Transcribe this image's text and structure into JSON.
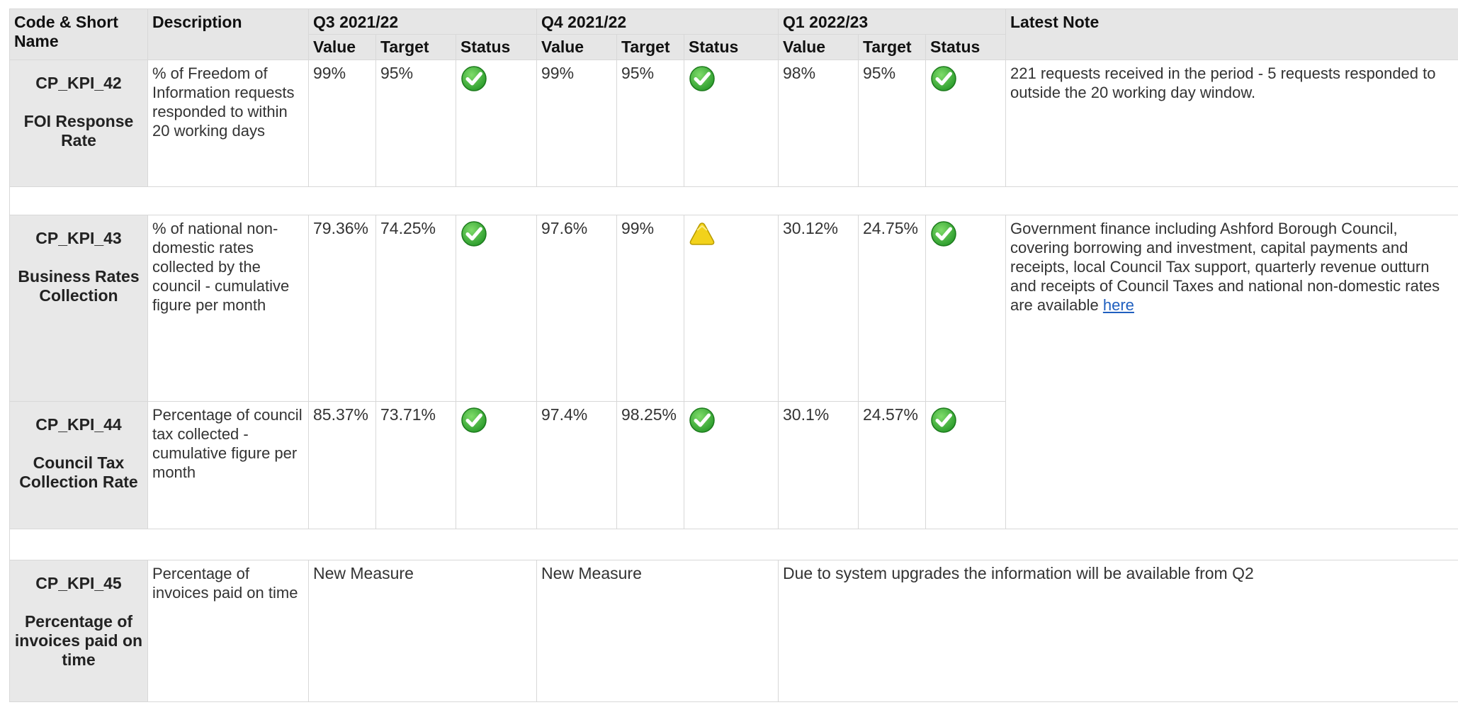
{
  "headers": {
    "code_name": "Code & Short Name",
    "description": "Description",
    "periods": [
      "Q3 2021/22",
      "Q4 2021/22",
      "Q1 2022/23"
    ],
    "value": "Value",
    "target": "Target",
    "status": "Status",
    "latest_note": "Latest Note"
  },
  "rows": [
    {
      "code": "CP_KPI_42",
      "name": "FOI Response Rate",
      "description": "% of Freedom of Information requests responded to within 20 working days",
      "q3": {
        "value": "99%",
        "target": "95%",
        "status": "check-icon"
      },
      "q4": {
        "value": "99%",
        "target": "95%",
        "status": "check-icon"
      },
      "q1": {
        "value": "98%",
        "target": "95%",
        "status": "check-icon"
      },
      "note": "221 requests received in the period - 5 requests responded to outside the 20 working day window."
    },
    {
      "code": "CP_KPI_43",
      "name": "Business Rates Collection",
      "description": "% of national non-domestic rates collected by the council - cumulative figure per month",
      "q3": {
        "value": "79.36%",
        "target": "74.25%",
        "status": "check-icon"
      },
      "q4": {
        "value": "97.6%",
        "target": "99%",
        "status": "warning-icon"
      },
      "q1": {
        "value": "30.12%",
        "target": "24.75%",
        "status": "check-icon"
      },
      "note": "Government finance including Ashford Borough Council, covering borrowing and investment, capital payments and receipts, local Council Tax support, quarterly revenue outturn and receipts of Council Taxes and national non-domestic rates are available",
      "note_link": "here"
    },
    {
      "code": "CP_KPI_44",
      "name": "Council Tax Collection Rate",
      "description": "Percentage of council tax collected - cumulative figure per month",
      "q3": {
        "value": "85.37%",
        "target": "73.71%",
        "status": "check-icon"
      },
      "q4": {
        "value": "97.4%",
        "target": "98.25%",
        "status": "check-icon"
      },
      "q1": {
        "value": "30.1%",
        "target": "24.57%",
        "status": "check-icon"
      }
    },
    {
      "code": "CP_KPI_45",
      "name": "Percentage of invoices paid on time",
      "description": "Percentage of invoices paid on time",
      "q3_text": "New Measure",
      "q4_text": "New Measure",
      "q1_note": "Due to system upgrades the information will be available from Q2"
    }
  ],
  "colors": {
    "header_bg": "#e6e6e6",
    "code_bg": "#e8e8e8",
    "check_green": "#2e9e2e",
    "warning_yellow": "#f2d21b",
    "link": "#1f5fbf"
  }
}
